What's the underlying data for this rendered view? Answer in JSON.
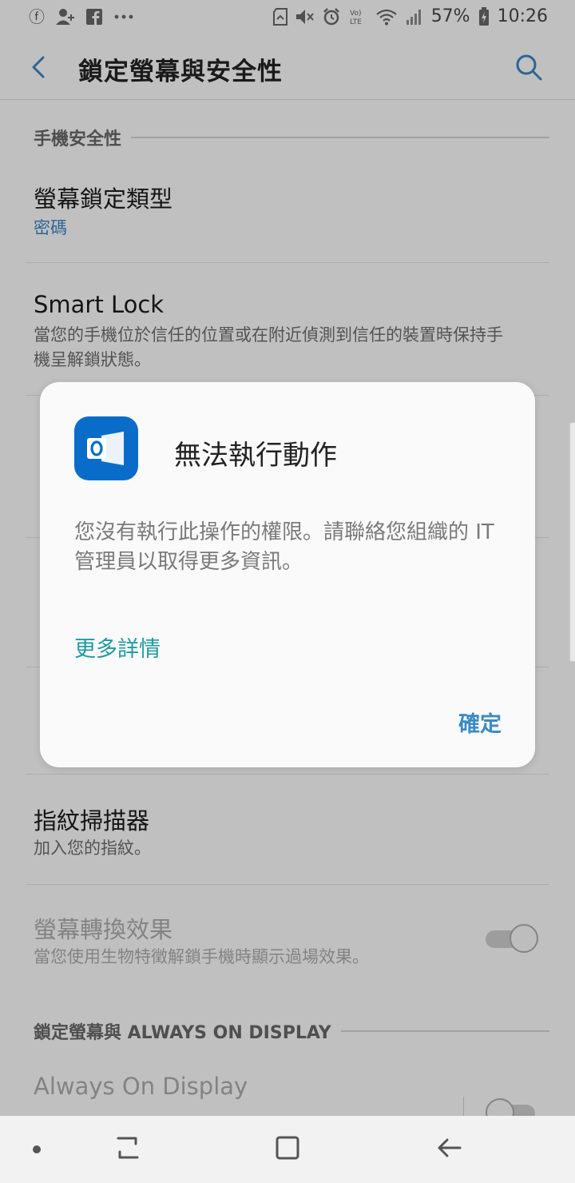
{
  "status_bar": {
    "battery_percent": "57%",
    "time": "10:26",
    "left_icons": [
      "info-icon",
      "add-contact-icon",
      "facebook-icon",
      "more-icon"
    ],
    "right_icons": [
      "sd-card-icon",
      "mute-icon",
      "alarm-icon",
      "volte-icon",
      "wifi-icon",
      "signal-icon",
      "battery-icon"
    ]
  },
  "app_bar": {
    "title": "鎖定螢幕與安全性",
    "back_icon": "chevron-left-icon",
    "search_icon": "search-icon",
    "accent_color": "#3a82c0"
  },
  "sections": {
    "phone_security": {
      "header": "手機安全性",
      "screen_lock": {
        "title": "螢幕鎖定類型",
        "value": "密碼"
      },
      "smart_lock": {
        "title": "Smart Lock",
        "subtitle": "當您的手機位於信任的位置或在附近偵測到信任的裝置時保持手機呈解鎖狀態。"
      },
      "fingerprint": {
        "title": "指紋掃描器",
        "subtitle": "加入您的指紋。"
      },
      "screen_transition": {
        "title": "螢幕轉換效果",
        "subtitle": "當您使用生物特徵解鎖手機時顯示過場效果。",
        "toggle_on": true
      }
    },
    "lock_aod": {
      "header": "鎖定螢幕與 ALWAYS ON DISPLAY",
      "always_on_display": {
        "title": "Always On Display",
        "toggle_on": false
      }
    }
  },
  "dialog": {
    "app_icon": "outlook-icon",
    "app_icon_color": "#0a6cc9",
    "title": "無法執行動作",
    "message": "您沒有執行此操作的權限。請聯絡您組織的 IT 管理員以取得更多資訊。",
    "link_label": "更多詳情",
    "link_color": "#1f9aa0",
    "ok_label": "確定",
    "ok_color": "#3a8bc4"
  },
  "nav_bar": {
    "icons": [
      "dot-icon",
      "recents-icon",
      "home-icon",
      "back-icon"
    ]
  }
}
